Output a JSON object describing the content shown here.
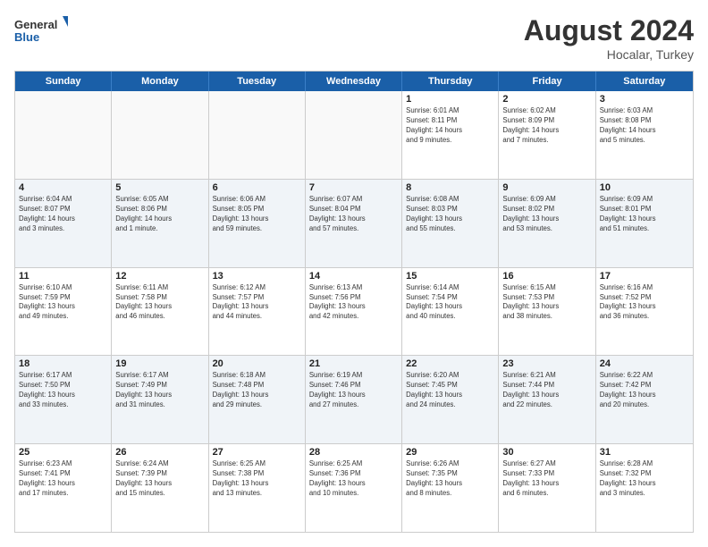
{
  "logo": {
    "general": "General",
    "blue": "Blue"
  },
  "title": "August 2024",
  "location": "Hocalar, Turkey",
  "days_of_week": [
    "Sunday",
    "Monday",
    "Tuesday",
    "Wednesday",
    "Thursday",
    "Friday",
    "Saturday"
  ],
  "weeks": [
    [
      {
        "day": "",
        "info": ""
      },
      {
        "day": "",
        "info": ""
      },
      {
        "day": "",
        "info": ""
      },
      {
        "day": "",
        "info": ""
      },
      {
        "day": "1",
        "info": "Sunrise: 6:01 AM\nSunset: 8:11 PM\nDaylight: 14 hours\nand 9 minutes."
      },
      {
        "day": "2",
        "info": "Sunrise: 6:02 AM\nSunset: 8:09 PM\nDaylight: 14 hours\nand 7 minutes."
      },
      {
        "day": "3",
        "info": "Sunrise: 6:03 AM\nSunset: 8:08 PM\nDaylight: 14 hours\nand 5 minutes."
      }
    ],
    [
      {
        "day": "4",
        "info": "Sunrise: 6:04 AM\nSunset: 8:07 PM\nDaylight: 14 hours\nand 3 minutes."
      },
      {
        "day": "5",
        "info": "Sunrise: 6:05 AM\nSunset: 8:06 PM\nDaylight: 14 hours\nand 1 minute."
      },
      {
        "day": "6",
        "info": "Sunrise: 6:06 AM\nSunset: 8:05 PM\nDaylight: 13 hours\nand 59 minutes."
      },
      {
        "day": "7",
        "info": "Sunrise: 6:07 AM\nSunset: 8:04 PM\nDaylight: 13 hours\nand 57 minutes."
      },
      {
        "day": "8",
        "info": "Sunrise: 6:08 AM\nSunset: 8:03 PM\nDaylight: 13 hours\nand 55 minutes."
      },
      {
        "day": "9",
        "info": "Sunrise: 6:09 AM\nSunset: 8:02 PM\nDaylight: 13 hours\nand 53 minutes."
      },
      {
        "day": "10",
        "info": "Sunrise: 6:09 AM\nSunset: 8:01 PM\nDaylight: 13 hours\nand 51 minutes."
      }
    ],
    [
      {
        "day": "11",
        "info": "Sunrise: 6:10 AM\nSunset: 7:59 PM\nDaylight: 13 hours\nand 49 minutes."
      },
      {
        "day": "12",
        "info": "Sunrise: 6:11 AM\nSunset: 7:58 PM\nDaylight: 13 hours\nand 46 minutes."
      },
      {
        "day": "13",
        "info": "Sunrise: 6:12 AM\nSunset: 7:57 PM\nDaylight: 13 hours\nand 44 minutes."
      },
      {
        "day": "14",
        "info": "Sunrise: 6:13 AM\nSunset: 7:56 PM\nDaylight: 13 hours\nand 42 minutes."
      },
      {
        "day": "15",
        "info": "Sunrise: 6:14 AM\nSunset: 7:54 PM\nDaylight: 13 hours\nand 40 minutes."
      },
      {
        "day": "16",
        "info": "Sunrise: 6:15 AM\nSunset: 7:53 PM\nDaylight: 13 hours\nand 38 minutes."
      },
      {
        "day": "17",
        "info": "Sunrise: 6:16 AM\nSunset: 7:52 PM\nDaylight: 13 hours\nand 36 minutes."
      }
    ],
    [
      {
        "day": "18",
        "info": "Sunrise: 6:17 AM\nSunset: 7:50 PM\nDaylight: 13 hours\nand 33 minutes."
      },
      {
        "day": "19",
        "info": "Sunrise: 6:17 AM\nSunset: 7:49 PM\nDaylight: 13 hours\nand 31 minutes."
      },
      {
        "day": "20",
        "info": "Sunrise: 6:18 AM\nSunset: 7:48 PM\nDaylight: 13 hours\nand 29 minutes."
      },
      {
        "day": "21",
        "info": "Sunrise: 6:19 AM\nSunset: 7:46 PM\nDaylight: 13 hours\nand 27 minutes."
      },
      {
        "day": "22",
        "info": "Sunrise: 6:20 AM\nSunset: 7:45 PM\nDaylight: 13 hours\nand 24 minutes."
      },
      {
        "day": "23",
        "info": "Sunrise: 6:21 AM\nSunset: 7:44 PM\nDaylight: 13 hours\nand 22 minutes."
      },
      {
        "day": "24",
        "info": "Sunrise: 6:22 AM\nSunset: 7:42 PM\nDaylight: 13 hours\nand 20 minutes."
      }
    ],
    [
      {
        "day": "25",
        "info": "Sunrise: 6:23 AM\nSunset: 7:41 PM\nDaylight: 13 hours\nand 17 minutes."
      },
      {
        "day": "26",
        "info": "Sunrise: 6:24 AM\nSunset: 7:39 PM\nDaylight: 13 hours\nand 15 minutes."
      },
      {
        "day": "27",
        "info": "Sunrise: 6:25 AM\nSunset: 7:38 PM\nDaylight: 13 hours\nand 13 minutes."
      },
      {
        "day": "28",
        "info": "Sunrise: 6:25 AM\nSunset: 7:36 PM\nDaylight: 13 hours\nand 10 minutes."
      },
      {
        "day": "29",
        "info": "Sunrise: 6:26 AM\nSunset: 7:35 PM\nDaylight: 13 hours\nand 8 minutes."
      },
      {
        "day": "30",
        "info": "Sunrise: 6:27 AM\nSunset: 7:33 PM\nDaylight: 13 hours\nand 6 minutes."
      },
      {
        "day": "31",
        "info": "Sunrise: 6:28 AM\nSunset: 7:32 PM\nDaylight: 13 hours\nand 3 minutes."
      }
    ]
  ]
}
